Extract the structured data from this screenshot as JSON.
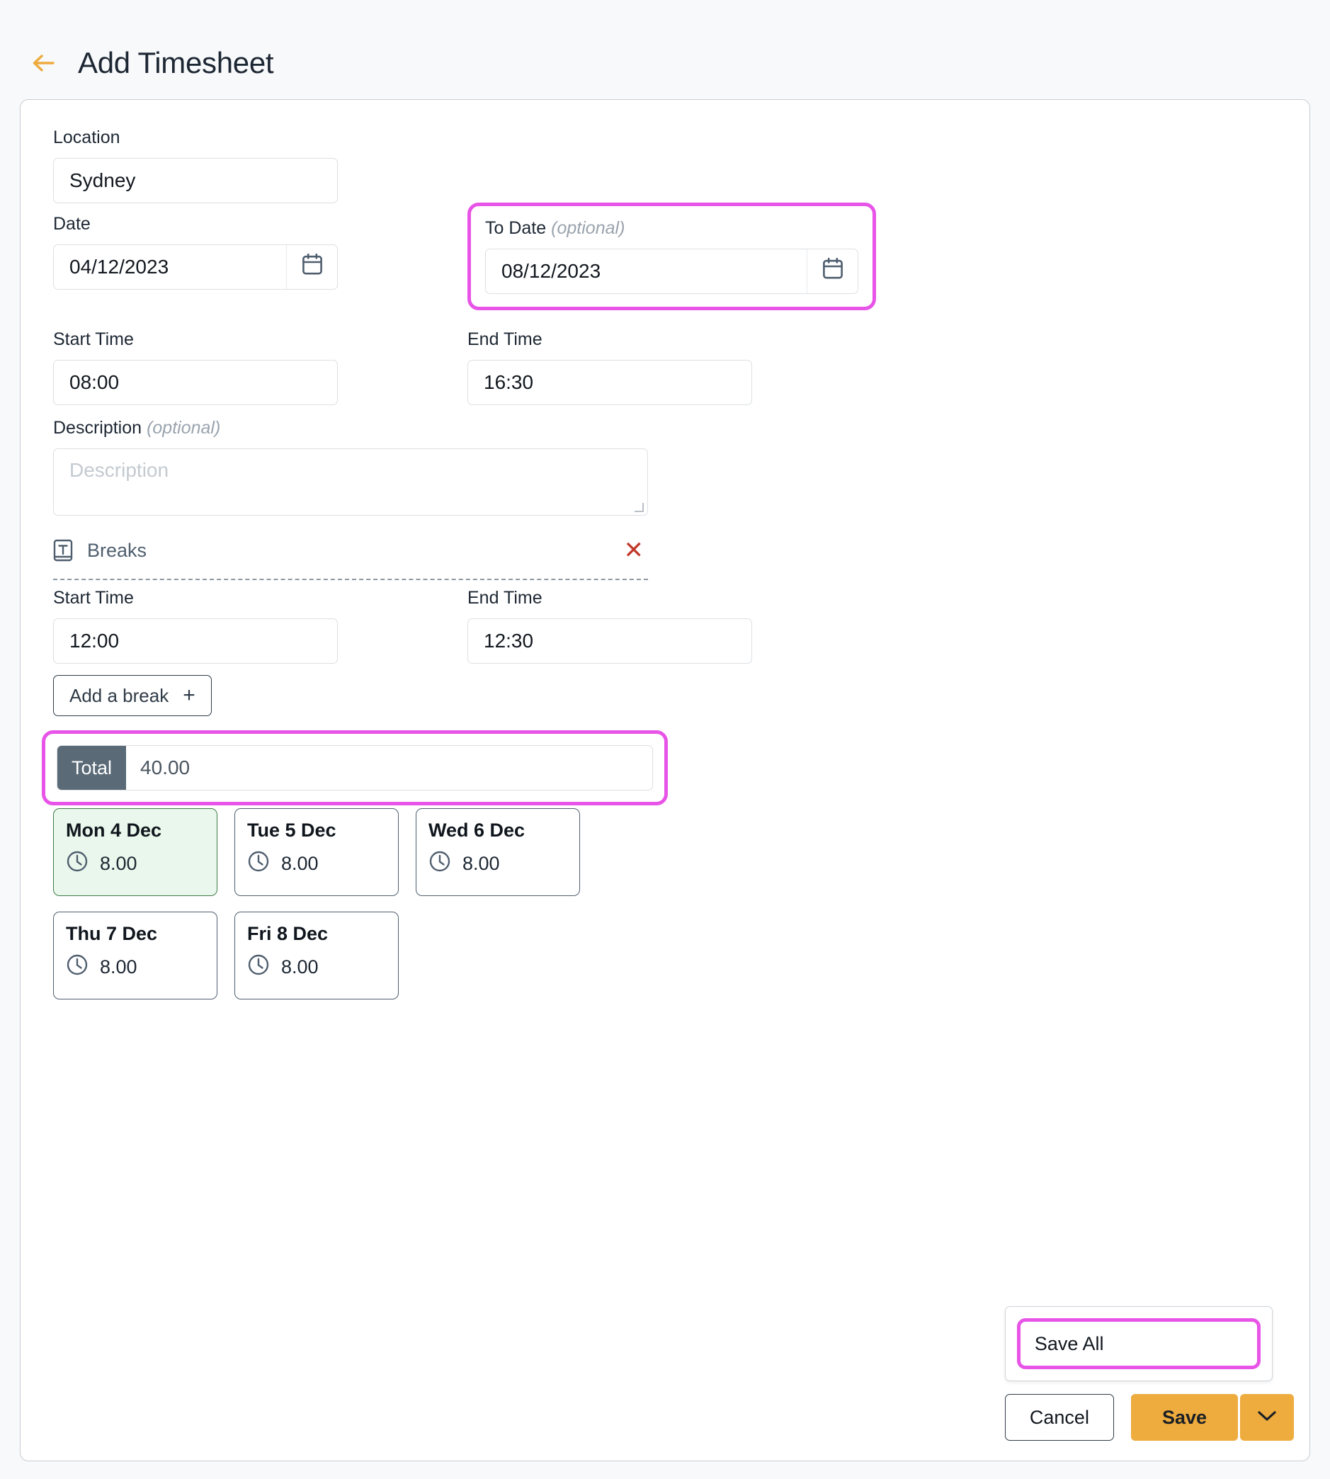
{
  "header": {
    "title": "Add Timesheet",
    "back_icon": "arrow-left-icon",
    "accent_color": "#eeab3e"
  },
  "form": {
    "location": {
      "label": "Location",
      "value": "Sydney"
    },
    "date": {
      "label": "Date",
      "value": "04/12/2023",
      "icon": "calendar-icon"
    },
    "to_date": {
      "label": "To Date",
      "optional": "(optional)",
      "value": "08/12/2023",
      "icon": "calendar-icon",
      "highlighted": true,
      "highlight_color": "#e754e7"
    },
    "start_time": {
      "label": "Start Time",
      "value": "08:00"
    },
    "end_time": {
      "label": "End Time",
      "value": "16:30"
    },
    "description": {
      "label": "Description",
      "optional": "(optional)",
      "value": "",
      "placeholder": "Description"
    }
  },
  "breaks": {
    "icon": "text-block-icon",
    "title": "Breaks",
    "remove_icon": "close-icon",
    "start_time": {
      "label": "Start Time",
      "value": "12:00"
    },
    "end_time": {
      "label": "End Time",
      "value": "12:30"
    },
    "add_break_label": "Add a break",
    "add_break_icon": "plus-icon"
  },
  "total": {
    "label": "Total",
    "value": "40.00",
    "highlighted": true,
    "highlight_color": "#e754e7"
  },
  "days": [
    {
      "name": "Mon 4 Dec",
      "hours": "8.00",
      "icon": "clock-icon",
      "selected": true
    },
    {
      "name": "Tue 5 Dec",
      "hours": "8.00",
      "icon": "clock-icon",
      "selected": false
    },
    {
      "name": "Wed 6 Dec",
      "hours": "8.00",
      "icon": "clock-icon",
      "selected": false
    },
    {
      "name": "Thu 7 Dec",
      "hours": "8.00",
      "icon": "clock-icon",
      "selected": false
    },
    {
      "name": "Fri 8 Dec",
      "hours": "8.00",
      "icon": "clock-icon",
      "selected": false
    }
  ],
  "footer": {
    "dropdown_open": true,
    "save_all_label": "Save All",
    "save_all_highlighted": true,
    "highlight_color": "#e754e7",
    "cancel_label": "Cancel",
    "save_label": "Save",
    "caret_icon": "chevron-down-icon"
  }
}
